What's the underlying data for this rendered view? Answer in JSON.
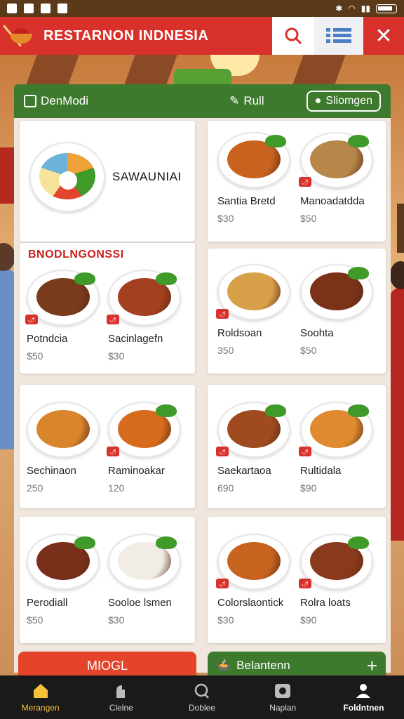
{
  "status_bar": {
    "battery_icon": "battery-icon"
  },
  "appbar": {
    "title": "RESTARNON INDNESIA",
    "search_icon": "search-icon",
    "list_icon": "list-icon",
    "close_icon": "close-icon"
  },
  "filterbar": {
    "mode_label": "DenModi",
    "full_label": "Rull",
    "choose_label": "Sliomgen"
  },
  "featured": {
    "title": "SAWAUNIAI"
  },
  "section": {
    "title": "BNODLNGONSSI"
  },
  "items": [
    {
      "name": "Santia Bretd",
      "price": "$30",
      "color": "#c8621e"
    },
    {
      "name": "Manoadatdda",
      "price": "$50",
      "color": "#b7864a"
    },
    {
      "name": "Potndcia",
      "price": "$50",
      "color": "#7a3a1c"
    },
    {
      "name": "Sacinlagefn",
      "price": "$30",
      "color": "#a2401f"
    },
    {
      "name": "Roldsoan",
      "price": "350",
      "color": "#d9a04a"
    },
    {
      "name": "Soohta",
      "price": "$50",
      "color": "#7c3218"
    },
    {
      "name": "Sechinaon",
      "price": "250",
      "color": "#d8852c"
    },
    {
      "name": "Raminoakar",
      "price": "120",
      "color": "#d66b1d"
    },
    {
      "name": "Saekartaoa",
      "price": "690",
      "color": "#a04a1f"
    },
    {
      "name": "Rultidala",
      "price": "$90",
      "color": "#df8a2e"
    },
    {
      "name": "Perodiall",
      "price": "$50",
      "color": "#7a2f1a"
    },
    {
      "name": "Sooloe lsmen",
      "price": "$30",
      "color": "#f1ede6"
    },
    {
      "name": "Colorslaontick",
      "price": "$30",
      "color": "#c7641f"
    },
    {
      "name": "Rolra loats",
      "price": "$90",
      "color": "#8a3a1c"
    }
  ],
  "bottom_cards": {
    "red_label": "MIOGL",
    "green_label": "Belantenn",
    "plus_icon": "plus-icon"
  },
  "bottom_nav": [
    {
      "label": "Merangen",
      "icon": "home-icon"
    },
    {
      "label": "Clelne",
      "icon": "chef-icon"
    },
    {
      "label": "Doblee",
      "icon": "search-icon"
    },
    {
      "label": "Naplan",
      "icon": "camera-icon"
    },
    {
      "label": "Foldntnen",
      "icon": "profile-icon"
    }
  ]
}
